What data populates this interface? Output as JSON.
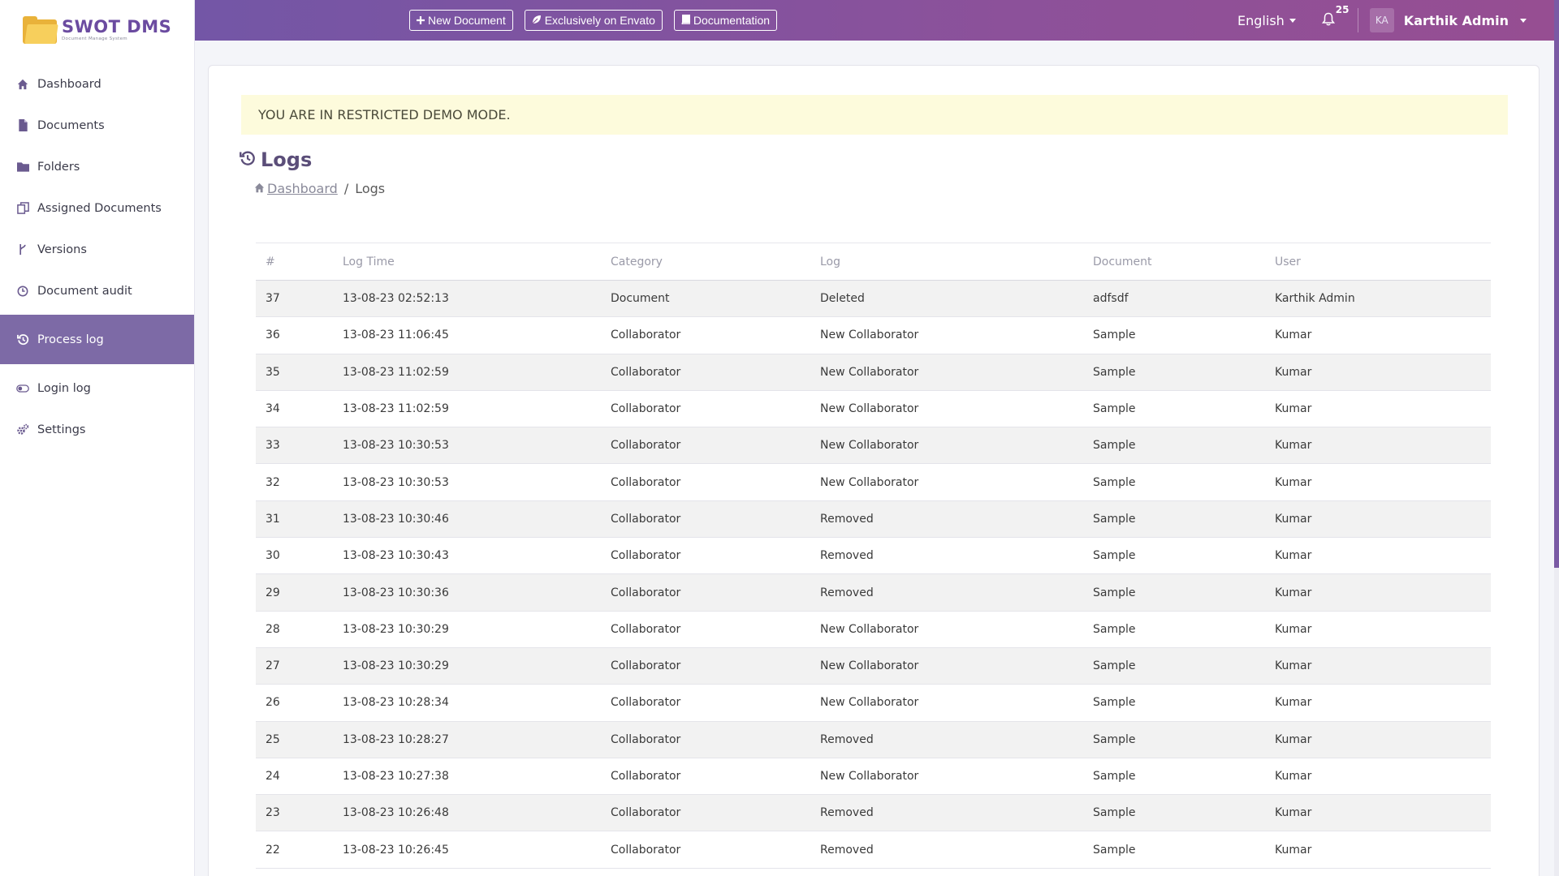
{
  "app": {
    "logo_title": "SWOT DMS",
    "logo_subtitle": "Document Manage System"
  },
  "sidebar": {
    "items": [
      {
        "label": "Dashboard",
        "icon": "home-icon"
      },
      {
        "label": "Documents",
        "icon": "file-icon"
      },
      {
        "label": "Folders",
        "icon": "folder-icon"
      },
      {
        "label": "Assigned Documents",
        "icon": "copy-icon"
      },
      {
        "label": "Versions",
        "icon": "branch-icon"
      },
      {
        "label": "Document audit",
        "icon": "clock-icon"
      },
      {
        "label": "Process log",
        "icon": "history-icon",
        "active": true
      },
      {
        "label": "Login log",
        "icon": "toggle-icon"
      },
      {
        "label": "Settings",
        "icon": "cogs-icon"
      }
    ]
  },
  "topbar": {
    "new_document": "New Document",
    "envato": "Exclusively on Envato",
    "documentation": "Documentation",
    "language": "English",
    "notifications": "25",
    "avatar_initials": "KA",
    "user_name": "Karthik Admin"
  },
  "alert": "YOU ARE IN RESTRICTED DEMO MODE.",
  "page": {
    "title": "Logs",
    "breadcrumb_home": "Dashboard",
    "breadcrumb_current": "Logs",
    "breadcrumb_sep": "/"
  },
  "table": {
    "headers": [
      "#",
      "Log Time",
      "Category",
      "Log",
      "Document",
      "User"
    ],
    "rows": [
      [
        "37",
        "13-08-23 02:52:13",
        "Document",
        "Deleted",
        "adfsdf",
        "Karthik Admin"
      ],
      [
        "36",
        "13-08-23 11:06:45",
        "Collaborator",
        "New Collaborator",
        "Sample",
        "Kumar"
      ],
      [
        "35",
        "13-08-23 11:02:59",
        "Collaborator",
        "New Collaborator",
        "Sample",
        "Kumar"
      ],
      [
        "34",
        "13-08-23 11:02:59",
        "Collaborator",
        "New Collaborator",
        "Sample",
        "Kumar"
      ],
      [
        "33",
        "13-08-23 10:30:53",
        "Collaborator",
        "New Collaborator",
        "Sample",
        "Kumar"
      ],
      [
        "32",
        "13-08-23 10:30:53",
        "Collaborator",
        "New Collaborator",
        "Sample",
        "Kumar"
      ],
      [
        "31",
        "13-08-23 10:30:46",
        "Collaborator",
        "Removed",
        "Sample",
        "Kumar"
      ],
      [
        "30",
        "13-08-23 10:30:43",
        "Collaborator",
        "Removed",
        "Sample",
        "Kumar"
      ],
      [
        "29",
        "13-08-23 10:30:36",
        "Collaborator",
        "Removed",
        "Sample",
        "Kumar"
      ],
      [
        "28",
        "13-08-23 10:30:29",
        "Collaborator",
        "New Collaborator",
        "Sample",
        "Kumar"
      ],
      [
        "27",
        "13-08-23 10:30:29",
        "Collaborator",
        "New Collaborator",
        "Sample",
        "Kumar"
      ],
      [
        "26",
        "13-08-23 10:28:34",
        "Collaborator",
        "New Collaborator",
        "Sample",
        "Kumar"
      ],
      [
        "25",
        "13-08-23 10:28:27",
        "Collaborator",
        "Removed",
        "Sample",
        "Kumar"
      ],
      [
        "24",
        "13-08-23 10:27:38",
        "Collaborator",
        "New Collaborator",
        "Sample",
        "Kumar"
      ],
      [
        "23",
        "13-08-23 10:26:48",
        "Collaborator",
        "Removed",
        "Sample",
        "Kumar"
      ],
      [
        "22",
        "13-08-23 10:26:45",
        "Collaborator",
        "Removed",
        "Sample",
        "Kumar"
      ]
    ]
  },
  "colors": {
    "accent": "#7d6aa6",
    "topbar_start": "#7356a6",
    "topbar_end": "#964e92",
    "alert_bg": "#fdfbdc"
  }
}
